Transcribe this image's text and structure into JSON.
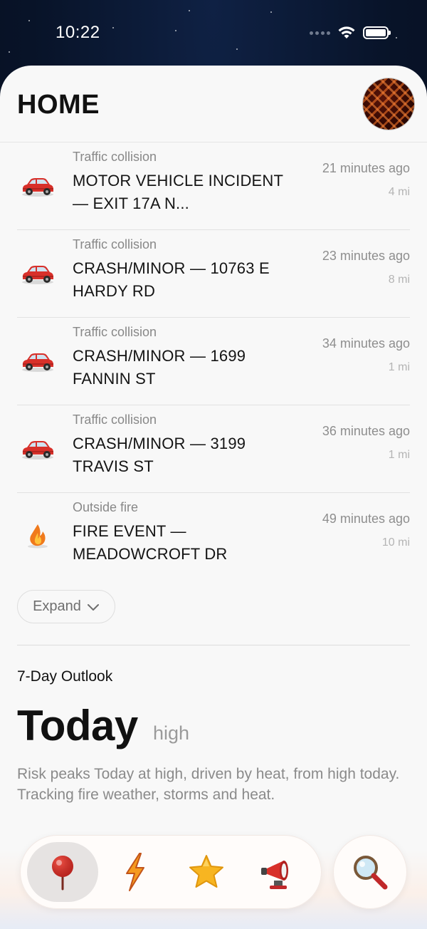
{
  "status_bar": {
    "time": "10:22"
  },
  "header": {
    "title": "HOME"
  },
  "incidents": [
    {
      "category": "Traffic collision",
      "title": "MOTOR VEHICLE INCIDENT — EXIT 17A N...",
      "time": "21 minutes ago",
      "distance": "4 mi",
      "icon": "car-icon"
    },
    {
      "category": "Traffic collision",
      "title": "CRASH/MINOR — 10763 E HARDY RD",
      "time": "23 minutes ago",
      "distance": "8 mi",
      "icon": "car-icon"
    },
    {
      "category": "Traffic collision",
      "title": "CRASH/MINOR — 1699 FANNIN ST",
      "time": "34 minutes ago",
      "distance": "1 mi",
      "icon": "car-icon"
    },
    {
      "category": "Traffic collision",
      "title": "CRASH/MINOR — 3199 TRAVIS ST",
      "time": "36 minutes ago",
      "distance": "1 mi",
      "icon": "car-icon"
    },
    {
      "category": "Outside fire",
      "title": "FIRE EVENT — MEADOWCROFT DR",
      "time": "49 minutes ago",
      "distance": "10 mi",
      "icon": "fire-icon"
    }
  ],
  "expand": {
    "label": "Expand"
  },
  "outlook": {
    "label": "7-Day Outlook",
    "day": "Today",
    "level": "high",
    "description": "Risk peaks Today at high, driven by heat, from high today. Tracking fire weather, storms and heat."
  },
  "nav": {
    "items": [
      {
        "icon": "map-pin-icon",
        "active": true
      },
      {
        "icon": "lightning-icon",
        "active": false
      },
      {
        "icon": "star-icon",
        "active": false
      },
      {
        "icon": "siren-icon",
        "active": false
      }
    ],
    "search_icon": "magnifier-icon"
  },
  "colors": {
    "accent_red": "#d8302a",
    "title_text": "#111111",
    "muted_text": "#888888"
  }
}
